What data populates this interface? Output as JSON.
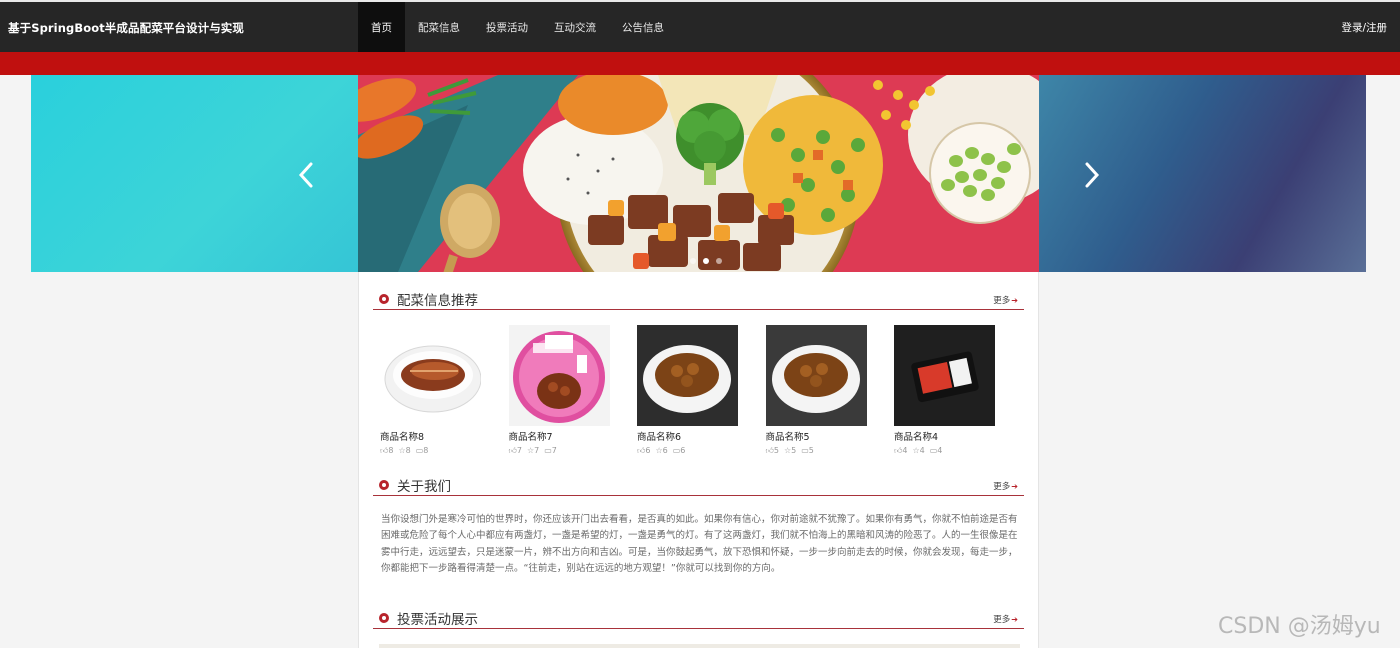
{
  "header": {
    "site_title": "基于SpringBoot半成品配菜平台设计与实现",
    "nav": [
      {
        "label": "首页",
        "active": true
      },
      {
        "label": "配菜信息",
        "active": false
      },
      {
        "label": "投票活动",
        "active": false
      },
      {
        "label": "互动交流",
        "active": false
      },
      {
        "label": "公告信息",
        "active": false
      }
    ],
    "login_label": "登录/注册"
  },
  "carousel": {
    "prev_icon": "chevron-left-icon",
    "next_icon": "chevron-right-icon",
    "dots_count": 3,
    "active_dot": 1
  },
  "sections": {
    "dishes": {
      "title": "配菜信息推荐",
      "more": "更多",
      "items": [
        {
          "name": "商品名称8",
          "likes": "8",
          "favorites": "8",
          "comments": "8"
        },
        {
          "name": "商品名称7",
          "likes": "7",
          "favorites": "7",
          "comments": "7"
        },
        {
          "name": "商品名称6",
          "likes": "6",
          "favorites": "6",
          "comments": "6"
        },
        {
          "name": "商品名称5",
          "likes": "5",
          "favorites": "5",
          "comments": "5"
        },
        {
          "name": "商品名称4",
          "likes": "4",
          "favorites": "4",
          "comments": "4"
        }
      ]
    },
    "about": {
      "title": "关于我们",
      "more": "更多",
      "text": "当你设想门外是寒冷可怕的世界时，你还应该开门出去看看，是否真的如此。如果你有信心，你对前途就不犹豫了。如果你有勇气，你就不怕前途是否有困难或危险了每个人心中都应有两盏灯，一盏是希望的灯，一盏是勇气的灯。有了这两盏灯，我们就不怕海上的黑暗和风涛的险恶了。人的一生很像是在雾中行走，远远望去，只是迷蒙一片，辨不出方向和吉凶。可是，当你鼓起勇气，放下恐惧和怀疑，一步一步向前走去的时候，你就会发现，每走一步，你都能把下一步路看得清楚一点。“往前走，别站在远远的地方观望！”你就可以找到你的方向。"
    },
    "votes": {
      "title": "投票活动展示",
      "more": "更多"
    }
  },
  "watermark": "CSDN @汤姆yu",
  "colors": {
    "nav_bg": "#262626",
    "accent_red": "#c0100f",
    "section_red": "#b8242c"
  }
}
